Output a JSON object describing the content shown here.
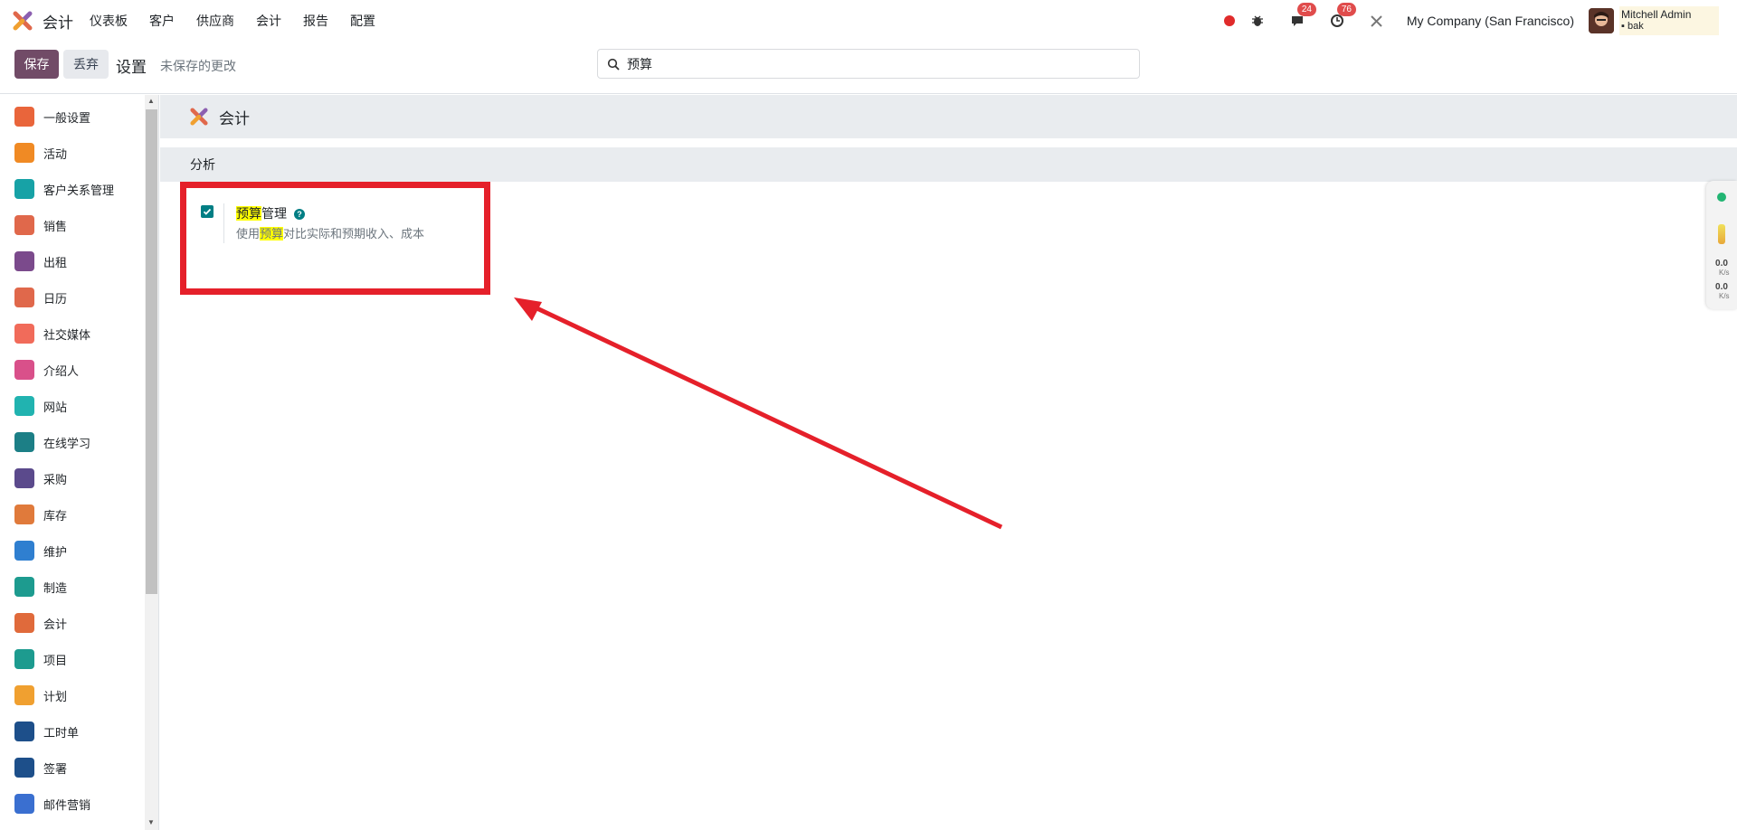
{
  "topnav": {
    "app_name": "会计",
    "menu": [
      "仪表板",
      "客户",
      "供应商",
      "会计",
      "报告",
      "配置"
    ],
    "chat_badge": "24",
    "activity_badge": "76",
    "company": "My Company (San Francisco)",
    "user_name": "Mitchell Admin",
    "user_db": "bak"
  },
  "control": {
    "save_label": "保存",
    "discard_label": "丢弃",
    "title": "设置",
    "unsaved": "未保存的更改",
    "search_value": "预算"
  },
  "sidebar": {
    "items": [
      {
        "label": "一般设置",
        "color": "#e9653b"
      },
      {
        "label": "活动",
        "color": "#f08a24"
      },
      {
        "label": "客户关系管理",
        "color": "#17a2a6"
      },
      {
        "label": "销售",
        "color": "#e0684b"
      },
      {
        "label": "出租",
        "color": "#7b4a8c"
      },
      {
        "label": "日历",
        "color": "#e0684b"
      },
      {
        "label": "社交媒体",
        "color": "#f16b5a"
      },
      {
        "label": "介绍人",
        "color": "#d9508a"
      },
      {
        "label": "网站",
        "color": "#21b3b0"
      },
      {
        "label": "在线学习",
        "color": "#1c7f86"
      },
      {
        "label": "采购",
        "color": "#5b4a8c"
      },
      {
        "label": "库存",
        "color": "#e07a3b"
      },
      {
        "label": "维护",
        "color": "#2f7fd0"
      },
      {
        "label": "制造",
        "color": "#1d9b8f"
      },
      {
        "label": "会计",
        "color": "#e06a3b"
      },
      {
        "label": "项目",
        "color": "#1d9b8f"
      },
      {
        "label": "计划",
        "color": "#f0a030"
      },
      {
        "label": "工时单",
        "color": "#1d4f8a"
      },
      {
        "label": "签署",
        "color": "#1d4f8a"
      },
      {
        "label": "邮件营销",
        "color": "#3a6fd0"
      }
    ]
  },
  "main": {
    "app_title": "会计",
    "section_title": "分析",
    "setting": {
      "title_highlight": "预算",
      "title_rest": "管理",
      "desc_prefix": "使用",
      "desc_highlight": "预算",
      "desc_rest": "对比实际和预期收入、成本",
      "enabled": true
    }
  },
  "widget": {
    "up_value": "0.0",
    "down_value": "0.0",
    "unit": "K/s"
  },
  "colors": {
    "brand": "#714b67",
    "teal": "#017e84",
    "annotation_red": "#e5202a",
    "highlight": "#ffff00"
  }
}
